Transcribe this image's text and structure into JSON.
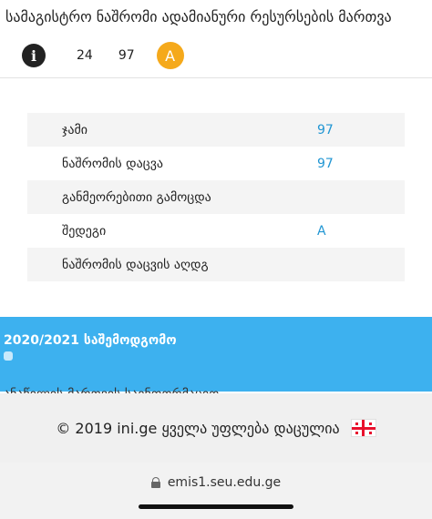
{
  "header": {
    "title": "სამაგისტრო ნაშრომი ადამიანური რესურსების მართვა",
    "info_icon": "info-icon",
    "score_a": "24",
    "score_b": "97",
    "grade": "A",
    "grade_color": "#f5a91b"
  },
  "details": {
    "rows": [
      {
        "label": "ჯამი",
        "value": "97"
      },
      {
        "label": "ნაშრომის დაცვა",
        "value": "97"
      },
      {
        "label": "განმეორებითი გამოცდა",
        "value": ""
      },
      {
        "label": "შედეგი",
        "value": "A"
      },
      {
        "label": "ნაშრომის დაცვის აღდგ",
        "value": ""
      }
    ],
    "value_color": "#2196d3"
  },
  "semester": {
    "label": "2020/2021 საშემოდგომო",
    "color": "#3db1ef"
  },
  "partial_row": {
    "text": "ანაწილის მართვის საინფორმაციო"
  },
  "footer": {
    "copyright": "© 2019 ini.ge ყველა უფლება დაცულია",
    "flag_icon": "georgia-flag-icon"
  },
  "browser": {
    "url": "emis1.seu.edu.ge",
    "lock_icon": "lock-icon"
  }
}
